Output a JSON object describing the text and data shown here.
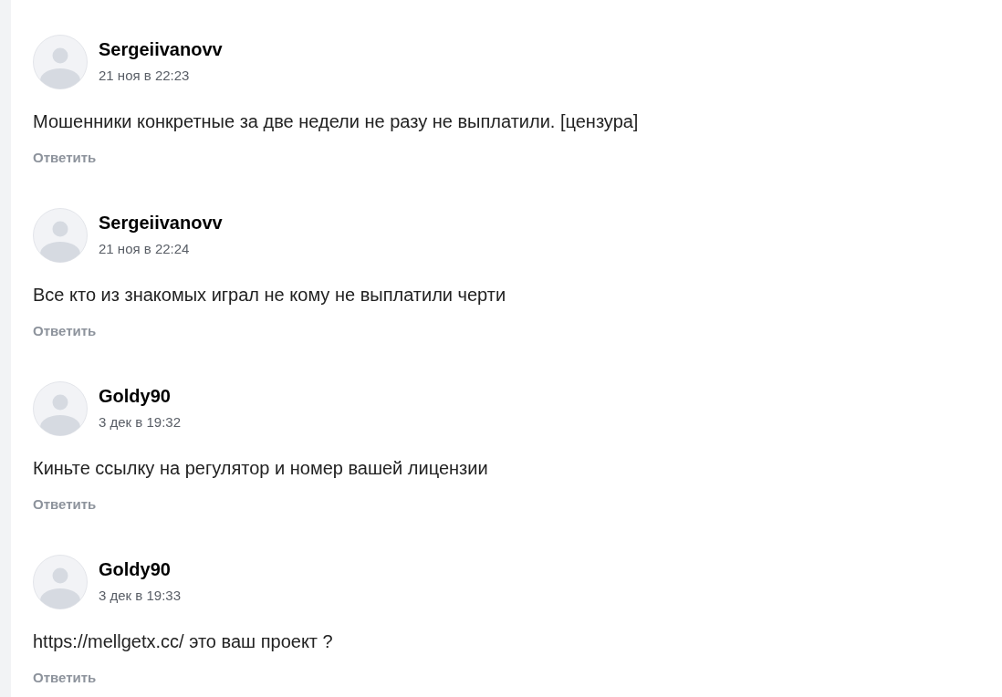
{
  "comments": [
    {
      "author": "Sergeiivanovv",
      "date": "21 ноя в 22:23",
      "text": "Мошенники конкретные за две недели не разу не выплатили. [цензура]",
      "reply": "Ответить"
    },
    {
      "author": "Sergeiivanovv",
      "date": "21 ноя в 22:24",
      "text": "Все кто из знакомых играл не кому не выплатили черти",
      "reply": "Ответить"
    },
    {
      "author": "Goldy90",
      "date": "3 дек в 19:32",
      "text": "Киньте ссылку на регулятор и номер вашей лицензии",
      "reply": "Ответить"
    },
    {
      "author": "Goldy90",
      "date": "3 дек в 19:33",
      "text": "https://mellgetx.cc/ это ваш проект ?",
      "reply": "Ответить"
    }
  ]
}
